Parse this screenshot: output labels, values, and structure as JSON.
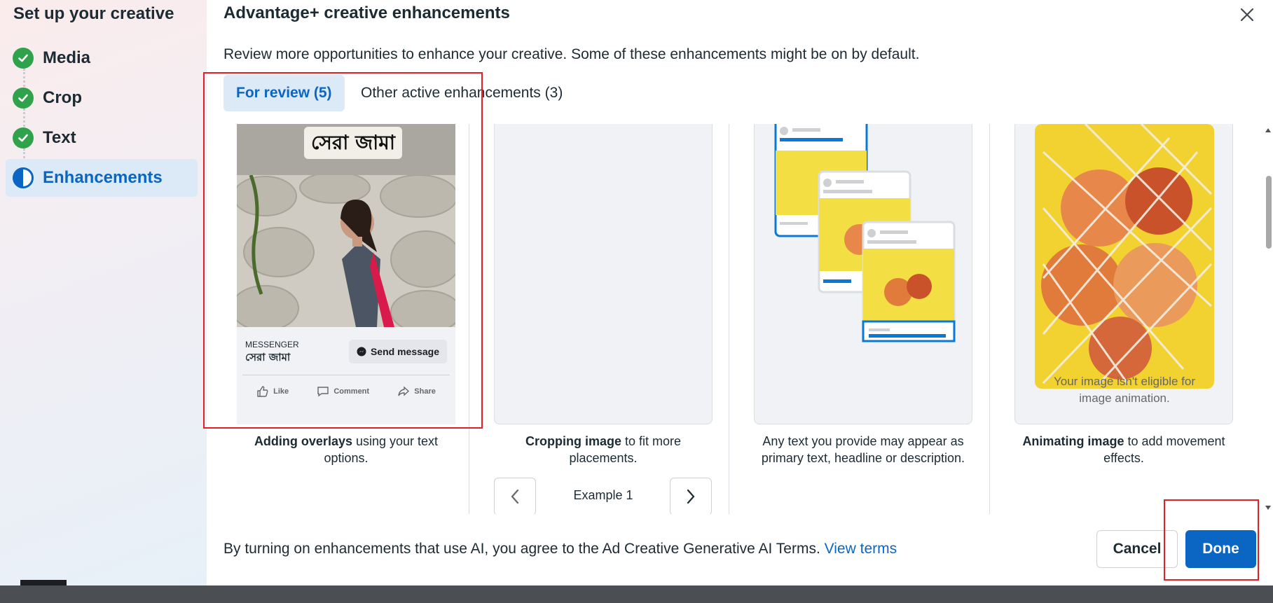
{
  "sidebar": {
    "title": "Set up your creative",
    "steps": [
      {
        "label": "Media",
        "state": "done"
      },
      {
        "label": "Crop",
        "state": "done"
      },
      {
        "label": "Text",
        "state": "done"
      },
      {
        "label": "Enhancements",
        "state": "active"
      }
    ]
  },
  "dialog": {
    "title": "Advantage+ creative enhancements",
    "subtitle": "Review more opportunities to enhance your creative. Some of these enhancements might be on by default.",
    "tabs": [
      {
        "label": "For review (5)",
        "active": true
      },
      {
        "label": "Other active enhancements (3)",
        "active": false
      }
    ],
    "cards": [
      {
        "caption_bold": "Adding overlays",
        "caption_rest": " using your text options.",
        "mock": {
          "overlay_text": "সেরা জামা",
          "messenger_label": "MESSENGER",
          "messenger_name": "সেরা জামা",
          "send_button": "Send message",
          "reactions": [
            "Like",
            "Comment",
            "Share"
          ]
        }
      },
      {
        "caption_bold": "Cropping image",
        "caption_rest": " to fit more placements.",
        "example_label": "Example 1"
      },
      {
        "caption_bold": "",
        "caption_rest": "Any text you provide may appear as primary text, headline or description."
      },
      {
        "caption_bold": "Animating image",
        "caption_rest": " to add movement effects.",
        "note": "Your image isn't eligible for image animation."
      }
    ],
    "footer": {
      "text": "By turning on enhancements that use AI, you agree to the Ad Creative Generative AI Terms.",
      "link": "View terms"
    },
    "buttons": {
      "cancel": "Cancel",
      "done": "Done"
    }
  },
  "colors": {
    "accent": "#0a66c2",
    "success": "#31a24c",
    "highlight": "#e41e26"
  }
}
